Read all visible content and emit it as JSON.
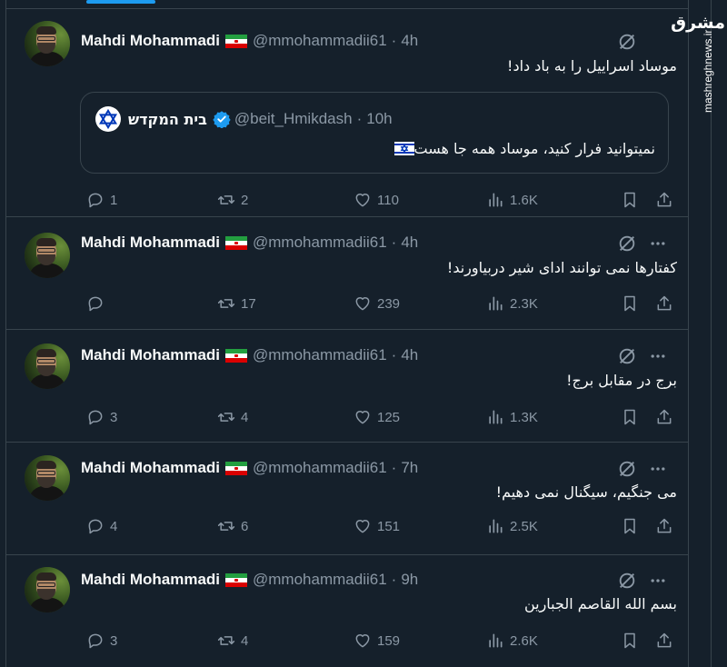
{
  "author": {
    "name": "Mahdi Mohammadi",
    "handle": "@mmohammadii61"
  },
  "tweets": [
    {
      "time": "4h",
      "text": "موساد اسراییل را به باد داد!",
      "quote": {
        "name": "בית המקדש",
        "handle": "@beit_Hmikdash",
        "time": "10h",
        "text": "نمیتوانید فرار کنید، موساد همه جا هست"
      },
      "replies": "1",
      "retweets": "2",
      "likes": "110",
      "views": "1.6K"
    },
    {
      "time": "4h",
      "text": "کفتارها نمی توانند ادای شیر دربیاورند!",
      "replies": "",
      "retweets": "17",
      "likes": "239",
      "views": "2.3K"
    },
    {
      "time": "4h",
      "text": "برج در مقابل برج!",
      "replies": "3",
      "retweets": "4",
      "likes": "125",
      "views": "1.3K"
    },
    {
      "time": "7h",
      "text": "می جنگیم، سیگنال نمی دهیم!",
      "replies": "4",
      "retweets": "6",
      "likes": "151",
      "views": "2.5K"
    },
    {
      "time": "9h",
      "text": "بسم الله القاصم الجبارین",
      "replies": "3",
      "retweets": "4",
      "likes": "159",
      "views": "2.6K"
    }
  ],
  "watermark": {
    "logo": "مشرق",
    "url": "mashreghnews.ir"
  },
  "colors": {
    "background": "#15202b",
    "border": "#38444d",
    "muted": "#8b98a5",
    "accent": "#1d9bf0"
  },
  "icons": {
    "reply": "reply-icon",
    "retweet": "retweet-icon",
    "like": "heart-icon",
    "views": "views-icon",
    "bookmark": "bookmark-icon",
    "share": "share-icon",
    "grok": "grok-icon",
    "more": "more-icon",
    "verified": "verified-badge-icon"
  }
}
